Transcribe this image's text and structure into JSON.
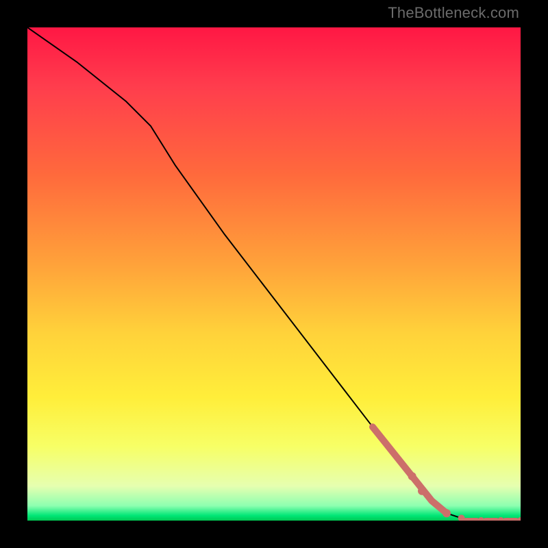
{
  "attribution": "TheBottleneck.com",
  "colors": {
    "line": "#000000",
    "dots": "#cc6f6a",
    "gradient_top": "#ff1744",
    "gradient_bottom": "#00c853"
  },
  "chart_data": {
    "type": "line",
    "title": "",
    "xlabel": "",
    "ylabel": "",
    "x": [
      0.0,
      0.1,
      0.2,
      0.25,
      0.3,
      0.4,
      0.5,
      0.6,
      0.7,
      0.78,
      0.82,
      0.85,
      0.88,
      0.9,
      0.92,
      0.94,
      0.96,
      0.98,
      1.0
    ],
    "values": [
      1.0,
      0.93,
      0.85,
      0.8,
      0.72,
      0.58,
      0.45,
      0.32,
      0.19,
      0.09,
      0.04,
      0.015,
      0.005,
      0.0,
      0.0,
      0.0,
      0.0,
      0.0,
      0.0
    ],
    "xlim": [
      0,
      1
    ],
    "ylim": [
      0,
      1
    ],
    "annotations": [],
    "highlight_points_x": [
      0.78,
      0.8,
      0.85,
      0.88,
      0.9,
      0.92,
      0.94,
      0.96,
      0.98,
      1.0
    ],
    "highlight_points_y": [
      0.09,
      0.06,
      0.015,
      0.005,
      0.0,
      0.0,
      0.0,
      0.0,
      0.0,
      0.0
    ]
  }
}
